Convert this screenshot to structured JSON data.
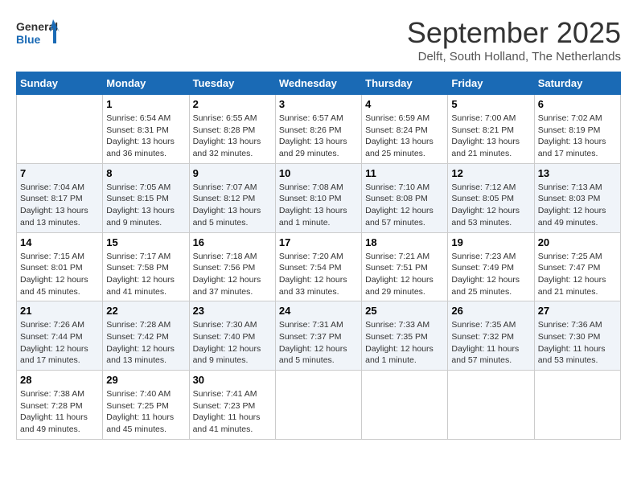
{
  "header": {
    "logo_general": "General",
    "logo_blue": "Blue",
    "month": "September 2025",
    "location": "Delft, South Holland, The Netherlands"
  },
  "weekdays": [
    "Sunday",
    "Monday",
    "Tuesday",
    "Wednesday",
    "Thursday",
    "Friday",
    "Saturday"
  ],
  "weeks": [
    [
      {
        "day": "",
        "info": ""
      },
      {
        "day": "1",
        "info": "Sunrise: 6:54 AM\nSunset: 8:31 PM\nDaylight: 13 hours\nand 36 minutes."
      },
      {
        "day": "2",
        "info": "Sunrise: 6:55 AM\nSunset: 8:28 PM\nDaylight: 13 hours\nand 32 minutes."
      },
      {
        "day": "3",
        "info": "Sunrise: 6:57 AM\nSunset: 8:26 PM\nDaylight: 13 hours\nand 29 minutes."
      },
      {
        "day": "4",
        "info": "Sunrise: 6:59 AM\nSunset: 8:24 PM\nDaylight: 13 hours\nand 25 minutes."
      },
      {
        "day": "5",
        "info": "Sunrise: 7:00 AM\nSunset: 8:21 PM\nDaylight: 13 hours\nand 21 minutes."
      },
      {
        "day": "6",
        "info": "Sunrise: 7:02 AM\nSunset: 8:19 PM\nDaylight: 13 hours\nand 17 minutes."
      }
    ],
    [
      {
        "day": "7",
        "info": "Sunrise: 7:04 AM\nSunset: 8:17 PM\nDaylight: 13 hours\nand 13 minutes."
      },
      {
        "day": "8",
        "info": "Sunrise: 7:05 AM\nSunset: 8:15 PM\nDaylight: 13 hours\nand 9 minutes."
      },
      {
        "day": "9",
        "info": "Sunrise: 7:07 AM\nSunset: 8:12 PM\nDaylight: 13 hours\nand 5 minutes."
      },
      {
        "day": "10",
        "info": "Sunrise: 7:08 AM\nSunset: 8:10 PM\nDaylight: 13 hours\nand 1 minute."
      },
      {
        "day": "11",
        "info": "Sunrise: 7:10 AM\nSunset: 8:08 PM\nDaylight: 12 hours\nand 57 minutes."
      },
      {
        "day": "12",
        "info": "Sunrise: 7:12 AM\nSunset: 8:05 PM\nDaylight: 12 hours\nand 53 minutes."
      },
      {
        "day": "13",
        "info": "Sunrise: 7:13 AM\nSunset: 8:03 PM\nDaylight: 12 hours\nand 49 minutes."
      }
    ],
    [
      {
        "day": "14",
        "info": "Sunrise: 7:15 AM\nSunset: 8:01 PM\nDaylight: 12 hours\nand 45 minutes."
      },
      {
        "day": "15",
        "info": "Sunrise: 7:17 AM\nSunset: 7:58 PM\nDaylight: 12 hours\nand 41 minutes."
      },
      {
        "day": "16",
        "info": "Sunrise: 7:18 AM\nSunset: 7:56 PM\nDaylight: 12 hours\nand 37 minutes."
      },
      {
        "day": "17",
        "info": "Sunrise: 7:20 AM\nSunset: 7:54 PM\nDaylight: 12 hours\nand 33 minutes."
      },
      {
        "day": "18",
        "info": "Sunrise: 7:21 AM\nSunset: 7:51 PM\nDaylight: 12 hours\nand 29 minutes."
      },
      {
        "day": "19",
        "info": "Sunrise: 7:23 AM\nSunset: 7:49 PM\nDaylight: 12 hours\nand 25 minutes."
      },
      {
        "day": "20",
        "info": "Sunrise: 7:25 AM\nSunset: 7:47 PM\nDaylight: 12 hours\nand 21 minutes."
      }
    ],
    [
      {
        "day": "21",
        "info": "Sunrise: 7:26 AM\nSunset: 7:44 PM\nDaylight: 12 hours\nand 17 minutes."
      },
      {
        "day": "22",
        "info": "Sunrise: 7:28 AM\nSunset: 7:42 PM\nDaylight: 12 hours\nand 13 minutes."
      },
      {
        "day": "23",
        "info": "Sunrise: 7:30 AM\nSunset: 7:40 PM\nDaylight: 12 hours\nand 9 minutes."
      },
      {
        "day": "24",
        "info": "Sunrise: 7:31 AM\nSunset: 7:37 PM\nDaylight: 12 hours\nand 5 minutes."
      },
      {
        "day": "25",
        "info": "Sunrise: 7:33 AM\nSunset: 7:35 PM\nDaylight: 12 hours\nand 1 minute."
      },
      {
        "day": "26",
        "info": "Sunrise: 7:35 AM\nSunset: 7:32 PM\nDaylight: 11 hours\nand 57 minutes."
      },
      {
        "day": "27",
        "info": "Sunrise: 7:36 AM\nSunset: 7:30 PM\nDaylight: 11 hours\nand 53 minutes."
      }
    ],
    [
      {
        "day": "28",
        "info": "Sunrise: 7:38 AM\nSunset: 7:28 PM\nDaylight: 11 hours\nand 49 minutes."
      },
      {
        "day": "29",
        "info": "Sunrise: 7:40 AM\nSunset: 7:25 PM\nDaylight: 11 hours\nand 45 minutes."
      },
      {
        "day": "30",
        "info": "Sunrise: 7:41 AM\nSunset: 7:23 PM\nDaylight: 11 hours\nand 41 minutes."
      },
      {
        "day": "",
        "info": ""
      },
      {
        "day": "",
        "info": ""
      },
      {
        "day": "",
        "info": ""
      },
      {
        "day": "",
        "info": ""
      }
    ]
  ]
}
